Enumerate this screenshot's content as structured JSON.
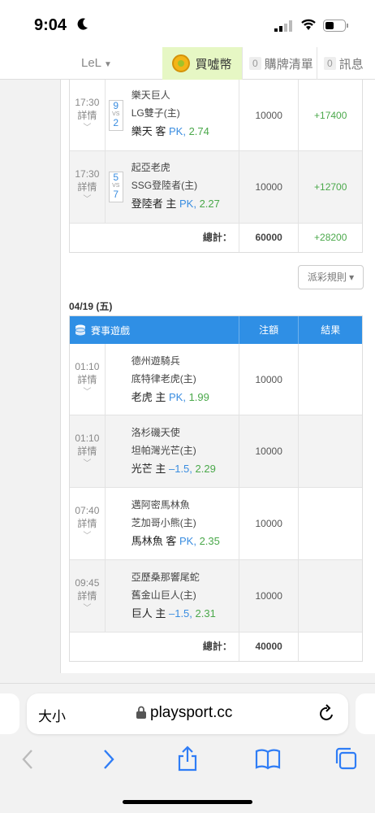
{
  "status": {
    "time": "9:04"
  },
  "nav": {
    "user": "LeL",
    "coin": "買噓幣",
    "cart_count": "0",
    "cart": "購牌清單",
    "msg_count": "0",
    "msg": "訊息"
  },
  "upper": {
    "rows": [
      {
        "time": "17:30",
        "detail": "詳情",
        "s1": "9",
        "s2": "2",
        "team1": "樂天巨人",
        "team2": "LG雙子(主)",
        "pick_team": "樂天 客",
        "pick_line": "PK,",
        "pick_odds": "2.74",
        "bet": "10000",
        "result": "+17400"
      },
      {
        "time": "17:30",
        "detail": "詳情",
        "s1": "5",
        "s2": "7",
        "team1": "起亞老虎",
        "team2": "SSG登陸者(主)",
        "pick_team": "登陸者 主",
        "pick_line": "PK,",
        "pick_odds": "2.27",
        "bet": "10000",
        "result": "+12700"
      }
    ],
    "total_label": "總計：",
    "total_amount": "60000",
    "total_result": "+28200"
  },
  "rule_button": "派彩規則 ▾",
  "section": {
    "date": "04/19 (五)",
    "header_game": "賽事遊戲",
    "header_bet": "注額",
    "header_result": "結果",
    "rows": [
      {
        "time": "01:10",
        "detail": "詳情",
        "team1": "德州遊騎兵",
        "team2": "底特律老虎(主)",
        "pick_team": "老虎 主",
        "pick_line": "PK,",
        "pick_odds": "1.99",
        "bet": "10000"
      },
      {
        "time": "01:10",
        "detail": "詳情",
        "team1": "洛杉磯天使",
        "team2": "坦帕灣光芒(主)",
        "pick_team": "光芒 主",
        "pick_line": "–1.5,",
        "pick_odds": "2.29",
        "bet": "10000"
      },
      {
        "time": "07:40",
        "detail": "詳情",
        "team1": "邁阿密馬林魚",
        "team2": "芝加哥小熊(主)",
        "pick_team": "馬林魚 客",
        "pick_line": "PK,",
        "pick_odds": "2.35",
        "bet": "10000"
      },
      {
        "time": "09:45",
        "detail": "詳情",
        "team1": "亞歷桑那響尾蛇",
        "team2": "舊金山巨人(主)",
        "pick_team": "巨人 主",
        "pick_line": "–1.5,",
        "pick_odds": "2.31",
        "bet": "10000"
      }
    ],
    "total_label": "總計：",
    "total_amount": "40000"
  },
  "browser": {
    "text_size": "大小",
    "url": "playsport.cc"
  }
}
